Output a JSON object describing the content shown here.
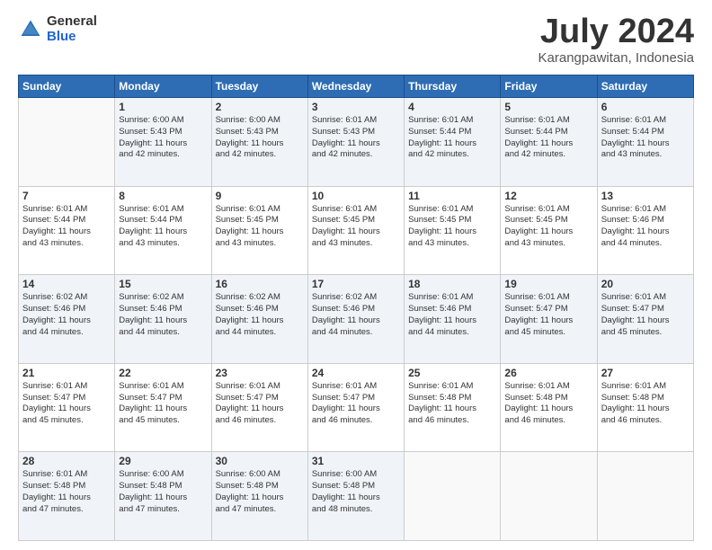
{
  "logo": {
    "general": "General",
    "blue": "Blue"
  },
  "title": {
    "month_year": "July 2024",
    "location": "Karangpawitan, Indonesia"
  },
  "weekdays": [
    "Sunday",
    "Monday",
    "Tuesday",
    "Wednesday",
    "Thursday",
    "Friday",
    "Saturday"
  ],
  "weeks": [
    [
      {
        "day": "",
        "detail": ""
      },
      {
        "day": "1",
        "detail": "Sunrise: 6:00 AM\nSunset: 5:43 PM\nDaylight: 11 hours\nand 42 minutes."
      },
      {
        "day": "2",
        "detail": "Sunrise: 6:00 AM\nSunset: 5:43 PM\nDaylight: 11 hours\nand 42 minutes."
      },
      {
        "day": "3",
        "detail": "Sunrise: 6:01 AM\nSunset: 5:43 PM\nDaylight: 11 hours\nand 42 minutes."
      },
      {
        "day": "4",
        "detail": "Sunrise: 6:01 AM\nSunset: 5:44 PM\nDaylight: 11 hours\nand 42 minutes."
      },
      {
        "day": "5",
        "detail": "Sunrise: 6:01 AM\nSunset: 5:44 PM\nDaylight: 11 hours\nand 42 minutes."
      },
      {
        "day": "6",
        "detail": "Sunrise: 6:01 AM\nSunset: 5:44 PM\nDaylight: 11 hours\nand 43 minutes."
      }
    ],
    [
      {
        "day": "7",
        "detail": "Sunrise: 6:01 AM\nSunset: 5:44 PM\nDaylight: 11 hours\nand 43 minutes."
      },
      {
        "day": "8",
        "detail": "Sunrise: 6:01 AM\nSunset: 5:44 PM\nDaylight: 11 hours\nand 43 minutes."
      },
      {
        "day": "9",
        "detail": "Sunrise: 6:01 AM\nSunset: 5:45 PM\nDaylight: 11 hours\nand 43 minutes."
      },
      {
        "day": "10",
        "detail": "Sunrise: 6:01 AM\nSunset: 5:45 PM\nDaylight: 11 hours\nand 43 minutes."
      },
      {
        "day": "11",
        "detail": "Sunrise: 6:01 AM\nSunset: 5:45 PM\nDaylight: 11 hours\nand 43 minutes."
      },
      {
        "day": "12",
        "detail": "Sunrise: 6:01 AM\nSunset: 5:45 PM\nDaylight: 11 hours\nand 43 minutes."
      },
      {
        "day": "13",
        "detail": "Sunrise: 6:01 AM\nSunset: 5:46 PM\nDaylight: 11 hours\nand 44 minutes."
      }
    ],
    [
      {
        "day": "14",
        "detail": "Sunrise: 6:02 AM\nSunset: 5:46 PM\nDaylight: 11 hours\nand 44 minutes."
      },
      {
        "day": "15",
        "detail": "Sunrise: 6:02 AM\nSunset: 5:46 PM\nDaylight: 11 hours\nand 44 minutes."
      },
      {
        "day": "16",
        "detail": "Sunrise: 6:02 AM\nSunset: 5:46 PM\nDaylight: 11 hours\nand 44 minutes."
      },
      {
        "day": "17",
        "detail": "Sunrise: 6:02 AM\nSunset: 5:46 PM\nDaylight: 11 hours\nand 44 minutes."
      },
      {
        "day": "18",
        "detail": "Sunrise: 6:01 AM\nSunset: 5:46 PM\nDaylight: 11 hours\nand 44 minutes."
      },
      {
        "day": "19",
        "detail": "Sunrise: 6:01 AM\nSunset: 5:47 PM\nDaylight: 11 hours\nand 45 minutes."
      },
      {
        "day": "20",
        "detail": "Sunrise: 6:01 AM\nSunset: 5:47 PM\nDaylight: 11 hours\nand 45 minutes."
      }
    ],
    [
      {
        "day": "21",
        "detail": "Sunrise: 6:01 AM\nSunset: 5:47 PM\nDaylight: 11 hours\nand 45 minutes."
      },
      {
        "day": "22",
        "detail": "Sunrise: 6:01 AM\nSunset: 5:47 PM\nDaylight: 11 hours\nand 45 minutes."
      },
      {
        "day": "23",
        "detail": "Sunrise: 6:01 AM\nSunset: 5:47 PM\nDaylight: 11 hours\nand 46 minutes."
      },
      {
        "day": "24",
        "detail": "Sunrise: 6:01 AM\nSunset: 5:47 PM\nDaylight: 11 hours\nand 46 minutes."
      },
      {
        "day": "25",
        "detail": "Sunrise: 6:01 AM\nSunset: 5:48 PM\nDaylight: 11 hours\nand 46 minutes."
      },
      {
        "day": "26",
        "detail": "Sunrise: 6:01 AM\nSunset: 5:48 PM\nDaylight: 11 hours\nand 46 minutes."
      },
      {
        "day": "27",
        "detail": "Sunrise: 6:01 AM\nSunset: 5:48 PM\nDaylight: 11 hours\nand 46 minutes."
      }
    ],
    [
      {
        "day": "28",
        "detail": "Sunrise: 6:01 AM\nSunset: 5:48 PM\nDaylight: 11 hours\nand 47 minutes."
      },
      {
        "day": "29",
        "detail": "Sunrise: 6:00 AM\nSunset: 5:48 PM\nDaylight: 11 hours\nand 47 minutes."
      },
      {
        "day": "30",
        "detail": "Sunrise: 6:00 AM\nSunset: 5:48 PM\nDaylight: 11 hours\nand 47 minutes."
      },
      {
        "day": "31",
        "detail": "Sunrise: 6:00 AM\nSunset: 5:48 PM\nDaylight: 11 hours\nand 48 minutes."
      },
      {
        "day": "",
        "detail": ""
      },
      {
        "day": "",
        "detail": ""
      },
      {
        "day": "",
        "detail": ""
      }
    ]
  ]
}
